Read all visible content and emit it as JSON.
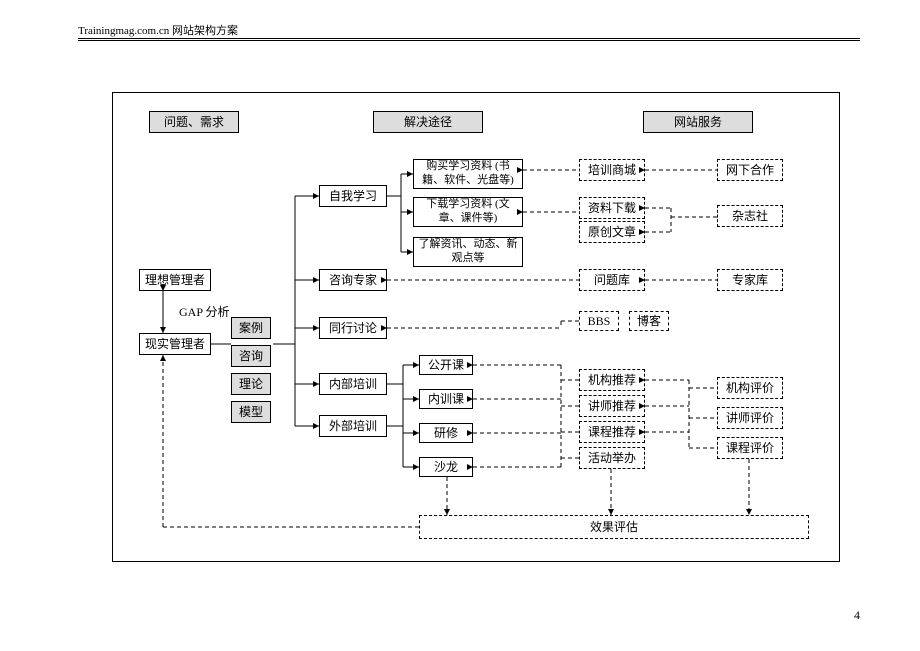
{
  "header": {
    "site_label": "Trainingmag.com.cn 网站架构方案",
    "page_number": "4"
  },
  "col_headers": {
    "problems": "问题、需求",
    "solutions": "解决途径",
    "services": "网站服务"
  },
  "managers": {
    "ideal": "理想管理者",
    "real": "现实管理者",
    "gap": "GAP 分析"
  },
  "tags": {
    "a": "案例",
    "b": "咨询",
    "c": "理论",
    "d": "模型"
  },
  "approaches": {
    "self_study": "自我学习",
    "consult": "咨询专家",
    "peer": "同行讨论",
    "internal": "内部培训",
    "external": "外部培训"
  },
  "self_study_sub": {
    "buy": "购买学习资料 (书籍、软件、光盘等)",
    "download": "下载学习资料 (文章、课件等)",
    "news": "了解资讯、动态、新观点等"
  },
  "training_sub": {
    "open": "公开课",
    "in": "内训课",
    "seminar": "研修",
    "salon": "沙龙"
  },
  "services": {
    "mall": "培训商城",
    "offline": "网下合作",
    "download": "资料下载",
    "magazine": "杂志社",
    "original": "原创文章",
    "qbank": "问题库",
    "experts": "专家库",
    "bbs": "BBS",
    "blog": "博客",
    "org_rec": "机构推荐",
    "org_eval": "机构评价",
    "lect_rec": "讲师推荐",
    "lect_eval": "讲师评价",
    "course_rec": "课程推荐",
    "course_eval": "课程评价",
    "event": "活动举办"
  },
  "eval": "效果评估"
}
